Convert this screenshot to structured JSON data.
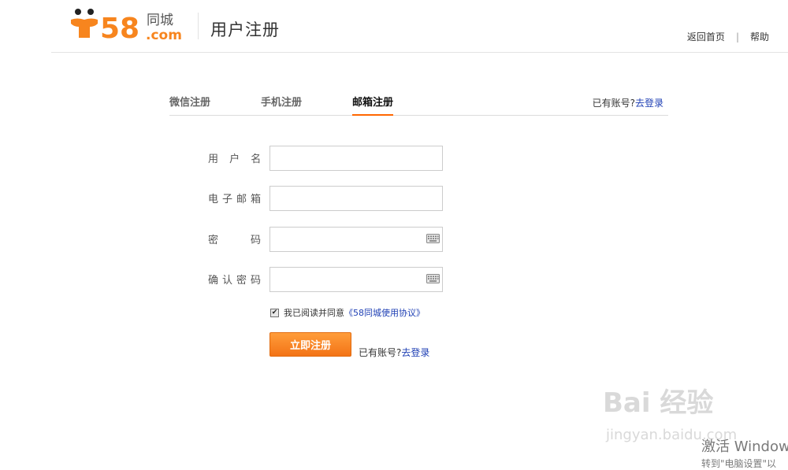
{
  "header": {
    "logo_text": "58同城.com",
    "page_title": "用户注册",
    "links": {
      "home": "返回首页",
      "sep": "|",
      "help": "帮助"
    }
  },
  "tabs": {
    "items": [
      {
        "label": "微信注册",
        "active": false
      },
      {
        "label": "手机注册",
        "active": false
      },
      {
        "label": "邮箱注册",
        "active": true
      }
    ],
    "login_hint": "已有账号?",
    "login_link": "去登录"
  },
  "form": {
    "username": {
      "label": "用 户 名",
      "value": ""
    },
    "email": {
      "label": "电子邮箱",
      "value": ""
    },
    "password": {
      "label": "密　　码",
      "value": "",
      "icon": "keyboard-icon"
    },
    "confirm": {
      "label": "确认密码",
      "value": "",
      "icon": "keyboard-icon"
    },
    "agree": {
      "checked": true,
      "text": "我已阅读并同意",
      "link": "《58同城使用协议》"
    },
    "submit": "立即注册",
    "bottom_hint": "已有账号?",
    "bottom_link": "去登录"
  },
  "watermark": {
    "baidu": "Bai 经验",
    "baidu_sub": "jingyan.baidu.com",
    "activate_title": "激活 Window",
    "activate_sub": "转到\"电脑设置\"以"
  },
  "colors": {
    "accent": "#ff6700",
    "link": "#1e3fb4",
    "button": "#f37316"
  }
}
